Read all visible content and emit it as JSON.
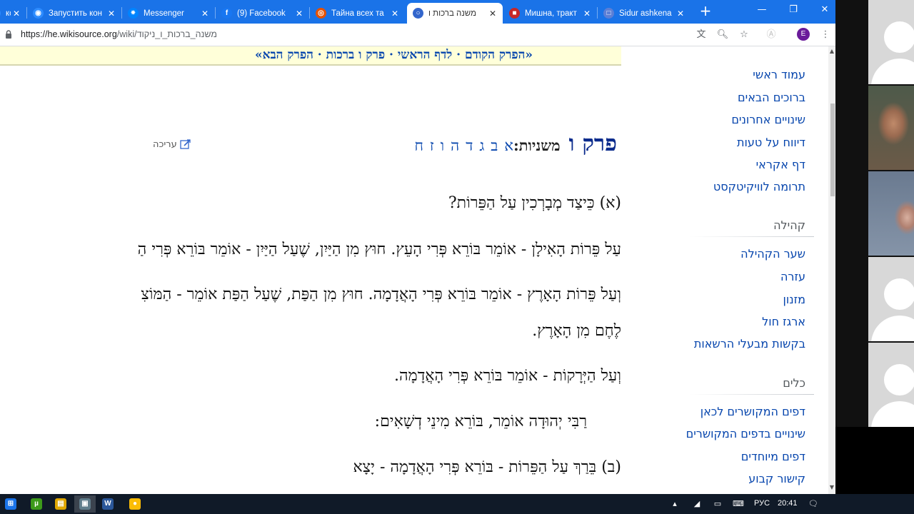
{
  "browser": {
    "tabs": [
      {
        "title": "кс",
        "icon": "zoom-icon",
        "color": "#2d8cff"
      },
      {
        "title": "Запустить кон",
        "icon": "zoom-icon",
        "color": "#2d8cff"
      },
      {
        "title": "Messenger",
        "icon": "messenger-icon",
        "color": "#0084ff"
      },
      {
        "title": "(9) Facebook",
        "icon": "facebook-icon",
        "color": "#1877f2"
      },
      {
        "title": "Тайна всех та",
        "icon": "site-icon",
        "color": "#e65100"
      },
      {
        "title": "משנה ברכות ו",
        "icon": "wikisource-icon",
        "color": "#3366cc",
        "active": true
      },
      {
        "title": "Мишна, тракт",
        "icon": "document-icon",
        "color": "#c62828"
      },
      {
        "title": "Sidur ashkena",
        "icon": "blank-page-icon",
        "color": "#5c7fd6"
      }
    ],
    "tab_close": "✕",
    "new_tab": "+",
    "window_controls": {
      "minimize": "—",
      "maximize": "❐",
      "close": "✕"
    },
    "url_host": "https://he.wikisource.org",
    "url_path": "/wiki/משנה_ברכות_ו_ניקוד",
    "profile_initial": "E"
  },
  "page": {
    "nav_banner": "«הפרק הקודם · לדף הראשי · פרק ו ברכות · הפרק הבא»",
    "chapter_title": "פרק ו",
    "mishnayot_label": "משניות:",
    "mishna_links": [
      "א",
      "ב",
      "ג",
      "ד",
      "ה",
      "ו",
      "ז",
      "ח"
    ],
    "edit_label": "עריכה",
    "paragraphs": [
      "(א) כֵּיצַד מְבָרְכִין עַל הַפֵּרוֹת?",
      "עַל פֵּרוֹת הָאִילָן - אוֹמֵר בּוֹרֵא פְּרִי הָעֵץ. חוּץ מִן הַיַּיִן, שֶׁעַל הַיַּיִן - אוֹמֵר בּוֹרֵא פְּרִי הַ",
      "וְעַל פֵּרוֹת הָאָרֶץ - אוֹמֵר בּוֹרֵא פְּרִי הָאֲדָמָה. חוּץ מִן הַפַּת, שֶׁעַל הַפַּת אוֹמֵר - הַמּוֹצִ",
      "לֶחֶם מִן הָאָרֶץ.",
      "וְעַל הַיְּרָקוֹת - אוֹמֵר בּוֹרֵא פְּרִי הָאֲדָמָה.",
      "רַבִּי יְהוּדָה אוֹמֵר, בּוֹרֵא מִינֵי דְשָׁאִים:",
      "(ב) בֵּרַךְ עַל הַפֵּרוֹת - בּוֹרֵא פְּרִי הָאֲדָמָה - יָצָא"
    ]
  },
  "sidebar": {
    "nav_links": [
      "עמוד ראשי",
      "ברוכים הבאים",
      "שינויים אחרונים",
      "דיווח על טעות",
      "דף אקראי",
      "תרומה לוויקיטקסט"
    ],
    "community_heading": "קהילה",
    "community_links": [
      "שער הקהילה",
      "עזרה",
      "מזנון",
      "ארגז חול",
      "בקשות מבעלי הרשאות"
    ],
    "tools_heading": "כלים",
    "tools_links": [
      "דפים המקושרים לכאן",
      "שינויים בדפים המקושרים",
      "דפים מיוחדים",
      "קישור קבוע"
    ]
  },
  "taskbar": {
    "apps": [
      {
        "name": "start-button",
        "glyph": "⊞",
        "color": "#1a73e8"
      },
      {
        "name": "utorrent-app",
        "glyph": "µ",
        "color": "#3c9a1a"
      },
      {
        "name": "file-explorer-app",
        "glyph": "▤",
        "color": "#e0a800"
      },
      {
        "name": "window-app",
        "glyph": "▣",
        "color": "#607d8b"
      },
      {
        "name": "word-app",
        "glyph": "W",
        "color": "#2b579a"
      },
      {
        "name": "chrome-app",
        "glyph": "●",
        "color": "#fbbc05"
      }
    ],
    "language": "РУС",
    "time": "20:41"
  },
  "colors": {
    "accent": "#1a73e8",
    "link": "#0645ad",
    "banner": "#ffffd9"
  }
}
